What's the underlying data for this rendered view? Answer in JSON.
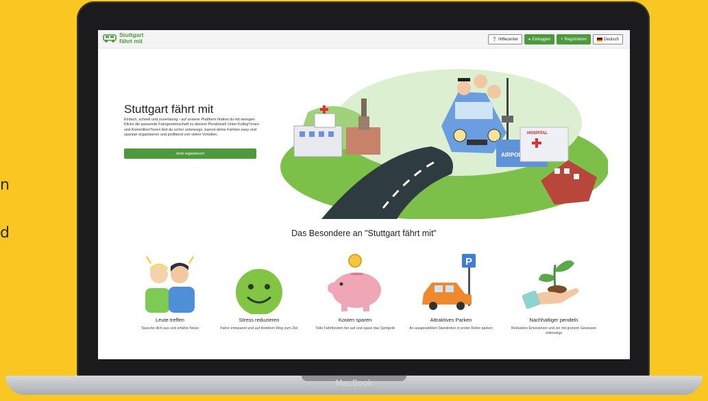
{
  "side_texts": [
    "n",
    "d"
  ],
  "device": {
    "brand_label": "MacBook"
  },
  "navbar": {
    "logo_line1": "Stuttgart",
    "logo_line2": "fährt mit",
    "help_label": "Hilfecenter",
    "login_label": "Einloggen",
    "register_label": "Registrieren",
    "language_label": "Deutsch"
  },
  "hero": {
    "title": "Stuttgart fährt mit",
    "description": "Einfach, schnell und zuverlässig - auf unserer Plattform findest du mit wenigen Klicks die passende Fahrgemeinschaft zu deinem Pendelziel! Unter Kolleg*innen und Kommiliton*innen bist du sicher unterwegs, kannst deine Fahrten easy und spontan organisieren und profitierst von vielen Vorteilen.",
    "cta_label": "Jetzt registrieren!",
    "illustration_labels": {
      "hospital": "HOSPITAL",
      "airport": "AIRPORT"
    }
  },
  "features": {
    "title": "Das Besondere an \"Stuttgart fährt mit\"",
    "items": [
      {
        "title": "Leute treffen",
        "description": "Tausche dich aus und erfahre News",
        "icon": "people-icon"
      },
      {
        "title": "Stress reduzieren",
        "description": "Fahre entspannt und auf direktem Weg zum Ziel",
        "icon": "smiley-icon"
      },
      {
        "title": "Kosten sparen",
        "description": "Teile Fahrtkosten fair auf und spare das Spritgeld",
        "icon": "piggy-bank-icon"
      },
      {
        "title": "Attraktives Parken",
        "description": "An ausgewählten Standorten in erster Reihe parken",
        "icon": "parking-car-icon",
        "sign_letter": "P"
      },
      {
        "title": "Nachhaltiger pendeln",
        "description": "Reduziere Emissionen und sei mit grünem Gewissen unterwegs",
        "icon": "plant-hand-icon"
      }
    ]
  },
  "colors": {
    "brand_green": "#4d9a3a",
    "background_yellow": "#F9C622",
    "laptop_dark": "#1b1b1d"
  }
}
